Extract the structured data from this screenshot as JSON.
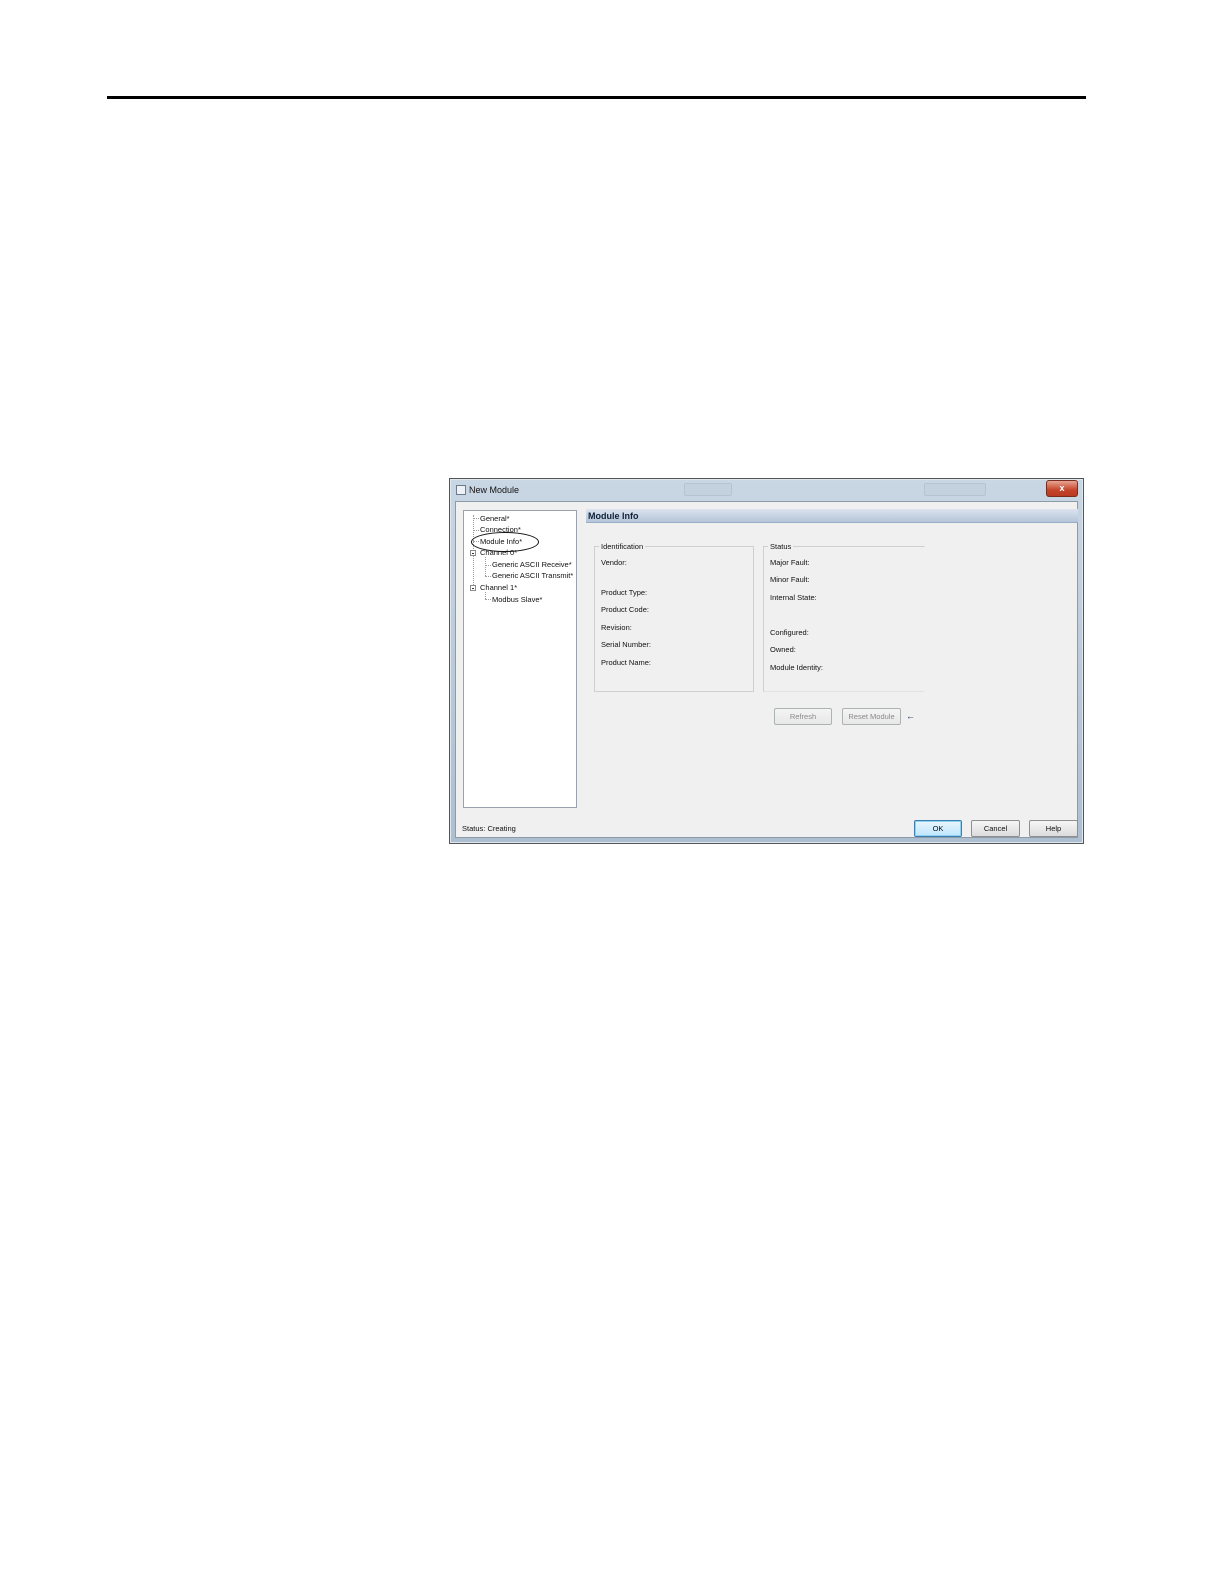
{
  "window": {
    "title": "New Module",
    "close_label": "x"
  },
  "tree": {
    "items": [
      {
        "label": "General*"
      },
      {
        "label": "Connection*"
      },
      {
        "label": "Module Info*"
      },
      {
        "label": "Channel 0*"
      },
      {
        "label": "Generic ASCII Receive*"
      },
      {
        "label": "Generic ASCII Transmit*"
      },
      {
        "label": "Channel 1*"
      },
      {
        "label": "Modbus Slave*"
      }
    ]
  },
  "panel": {
    "header": "Module Info",
    "identification": {
      "legend": "Identification",
      "fields": [
        "Vendor:",
        "Product Type:",
        "Product Code:",
        "Revision:",
        "Serial Number:",
        "Product Name:"
      ]
    },
    "status": {
      "legend": "Status",
      "fields": [
        "Major Fault:",
        "Minor Fault:",
        "Internal State:",
        "Configured:",
        "Owned:",
        "Module Identity:"
      ]
    },
    "refresh_label": "Refresh",
    "reset_label": "Reset Module"
  },
  "footer": {
    "status_label": "Status:",
    "status_value": "Creating",
    "ok_label": "OK",
    "cancel_label": "Cancel",
    "help_label": "Help"
  },
  "icons": {
    "arrow": "←"
  }
}
